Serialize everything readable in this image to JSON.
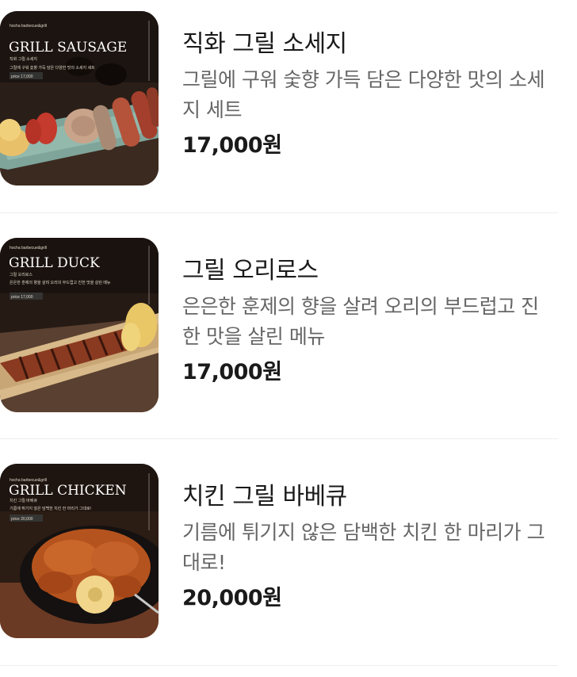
{
  "menu": [
    {
      "name": "직화 그릴 소세지",
      "description": "그릴에 구워 숯향 가득 담은 다양한 맛의 소세지 세트",
      "price": "17,000원",
      "image_overlay": {
        "brand": "hocha barbecue&grill",
        "title": "GRILL SAUSAGE",
        "subtitle": "직화 그릴 소세지",
        "blurb": "그릴에 구워 숯향 가득 담은 다양한 맛의 소세지 세트",
        "price": "price 17,000"
      }
    },
    {
      "name": "그릴 오리로스",
      "description": "은은한 훈제의 향을 살려 오리의 부드럽고 진한 맛을 살린 메뉴",
      "price": "17,000원",
      "image_overlay": {
        "brand": "hocha barbecue&grill",
        "title": "GRILL DUCK",
        "subtitle": "그릴 오리로스",
        "blurb": "은은한 훈제의 향을 살려 오리의 부드럽고 진한 맛을 살린 메뉴",
        "price": "price 17,000"
      }
    },
    {
      "name": "치킨 그릴 바베큐",
      "description": "기름에 튀기지 않은 담백한 치킨 한 마리가 그대로!",
      "price": "20,000원",
      "image_overlay": {
        "brand": "hocha barbecue&grill",
        "title": "GRILL CHICKEN",
        "subtitle": "치킨 그릴 바베큐",
        "blurb": "기름에 튀기지 않은 담백한 치킨 한 마리가 그대로!",
        "price": "price 20,000"
      }
    }
  ]
}
